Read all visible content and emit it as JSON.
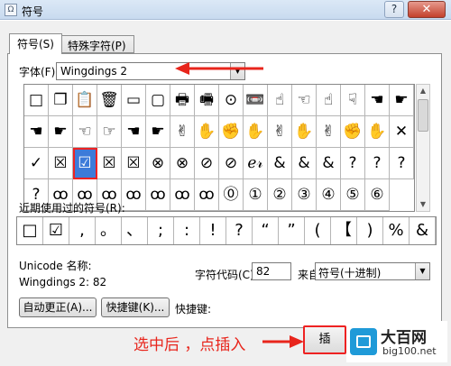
{
  "window": {
    "title": "符号",
    "help": "?",
    "close": "✕"
  },
  "tabs": [
    {
      "label": "符号(S)"
    },
    {
      "label": "特殊字符(P)"
    }
  ],
  "font": {
    "label": "字体(F):",
    "value": "Wingdings 2"
  },
  "symbols": [
    "□",
    "❐",
    "📋",
    "🗑",
    "▭",
    "▢",
    "🖶",
    "🖷",
    "⊙",
    "📼",
    "☝",
    "☜",
    "☝",
    "☟",
    "☚",
    "☛",
    "☚",
    "☛",
    "☜",
    "☞",
    "☚",
    "☛",
    "✌",
    "✋",
    "✊",
    "✋",
    "✌",
    "✋",
    "✌",
    "✊",
    "✋",
    "✕",
    "✓",
    "☒",
    "☑",
    "☒",
    "☒",
    "⊗",
    "⊗",
    "⊘",
    "⊘",
    "ℯ𝓇",
    "&",
    "&",
    "&",
    "?",
    "?",
    "?",
    "?",
    "ꝏ",
    "ꝏ",
    "ꝏ",
    "ꝏ",
    "ꝏ",
    "ꝏ",
    "ꝏ",
    "⓪",
    "①",
    "②",
    "③",
    "④",
    "⑤",
    "⑥"
  ],
  "selected_index": 34,
  "recent": {
    "label": "近期使用过的符号(R):",
    "items": [
      "□",
      "☑",
      ",",
      "。",
      "、",
      ";",
      ":",
      "!",
      "?",
      "“",
      "”",
      "(",
      "【",
      ")",
      "%",
      "&"
    ]
  },
  "unicode": {
    "label": "Unicode 名称:",
    "value": "Wingdings 2: 82"
  },
  "char_code": {
    "label": "字符代码(C):",
    "value": "82"
  },
  "from": {
    "label": "来自(M):",
    "value": "符号(十进制)"
  },
  "buttons": {
    "autocorrect": "自动更正(A)...",
    "shortcut_key": "快捷键(K)...",
    "shortcut_text": "快捷键:"
  },
  "annotation": "选中后 ，点插入",
  "insert_button": "插",
  "watermark": {
    "title": "大百网",
    "url": "big100.net"
  },
  "colors": {
    "annotation_red": "#e8251c",
    "selection_blue": "#3d7bd9",
    "watermark_blue": "#1f9ad8"
  }
}
